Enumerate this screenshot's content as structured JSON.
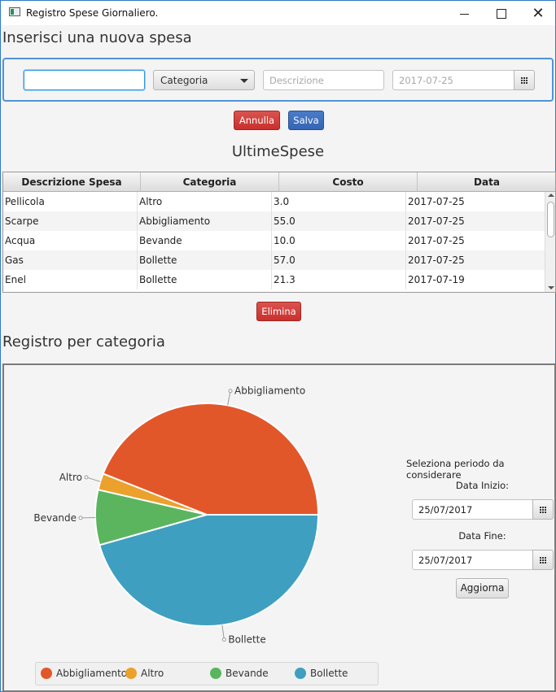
{
  "window": {
    "title": "Registro Spese Giornaliero."
  },
  "form": {
    "heading": "Inserisci una nuova spesa",
    "amount_value": "",
    "category_selected": "Categoria",
    "description_placeholder": "Descrizione",
    "date_placeholder": "2017-07-25",
    "cancel_label": "Annulla",
    "save_label": "Salva"
  },
  "recent": {
    "heading": "UltimeSpese",
    "columns": [
      "Descrizione Spesa",
      "Categoria",
      "Costo",
      "Data"
    ],
    "rows": [
      [
        "Pellicola",
        "Altro",
        "3.0",
        "2017-07-25"
      ],
      [
        "Scarpe",
        "Abbigliamento",
        "55.0",
        "2017-07-25"
      ],
      [
        "Acqua",
        "Bevande",
        "10.0",
        "2017-07-25"
      ],
      [
        "Gas",
        "Bollette",
        "57.0",
        "2017-07-25"
      ],
      [
        "Enel",
        "Bollette",
        "21.3",
        "2017-07-19"
      ]
    ],
    "delete_label": "Elimina"
  },
  "category_report": {
    "heading": "Registro per categoria",
    "period_prompt": "Seleziona periodo da considerare",
    "start_label": "Data Inizio:",
    "start_value": "25/07/2017",
    "end_label": "Data Fine:",
    "end_value": "25/07/2017",
    "refresh_label": "Aggiorna"
  },
  "chart_data": {
    "type": "pie",
    "categories": [
      "Abbigliamento",
      "Altro",
      "Bevande",
      "Bollette"
    ],
    "values": [
      55.0,
      3.0,
      10.0,
      57.0
    ],
    "colors": [
      "#e2572a",
      "#eba12b",
      "#5bb55f",
      "#3f9fc0"
    ],
    "legend": "bottom"
  }
}
